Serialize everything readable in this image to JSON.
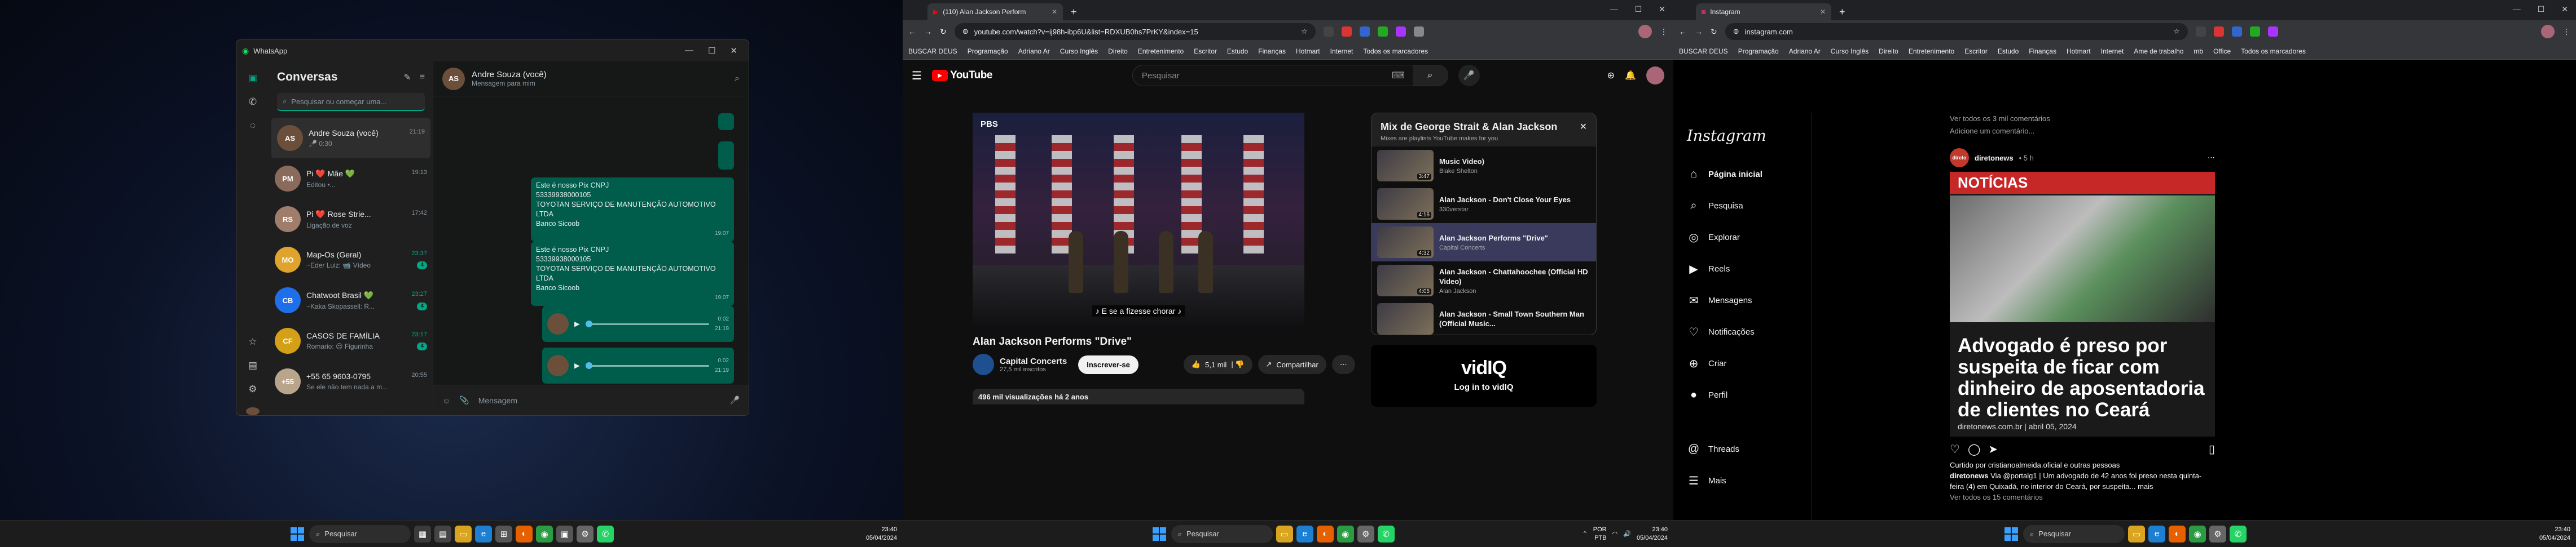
{
  "taskbar": {
    "search_placeholder": "Pesquisar",
    "time": "23:40",
    "date": "05/04/2024",
    "lang": "POR",
    "lang2": "PTB"
  },
  "whatsapp": {
    "title": "WhatsApp",
    "list_title": "Conversas",
    "search_placeholder": "Pesquisar ou começar uma...",
    "chats": [
      {
        "name": "Andre Souza (você)",
        "preview": "🎤 0:30",
        "time": "21:19",
        "badge": "",
        "color": "#6b4f3a",
        "initials": "AS"
      },
      {
        "name": "Pi ❤️ Mãe 💚",
        "preview": "Editou •...",
        "time": "19:13",
        "badge": "",
        "color": "#8a6a5a",
        "initials": "PM"
      },
      {
        "name": "Pi ❤️ Rose Strie...",
        "preview": "Ligação de voz",
        "time": "17:42",
        "badge": "",
        "color": "#a07d6a",
        "initials": "RS"
      },
      {
        "name": "Map-Os (Geral)",
        "preview": "~Eder Luiz: 📹 Vídeo",
        "time": "23:37",
        "badge": "4",
        "color": "#e0a32b",
        "initials": "MO"
      },
      {
        "name": "Chatwoot Brasil 💚",
        "preview": "~Kaka Skopassell: R...",
        "time": "23:27",
        "badge": "4",
        "color": "#1f6feb",
        "initials": "CB"
      },
      {
        "name": "CASOS DE FAMÍLIA",
        "preview": "Romario: 😍 Figurinha",
        "time": "23:17",
        "badge": "4",
        "color": "#d4a017",
        "initials": "CF"
      },
      {
        "name": "+55 65 9603-0795",
        "preview": "Se ele não tem nada a m...",
        "time": "20:55",
        "badge": "",
        "color": "#b8a58c",
        "initials": "+55"
      }
    ],
    "chat": {
      "name": "Andre Souza (você)",
      "subtitle": "Mensagem para mim",
      "messages": [
        {
          "text": "Este é nosso Pix CNPJ\n53339938000105\nTOYOTAN SERVIÇO DE MANUTENÇÃO AUTOMOTIVO LTDA\nBanco Sicoob",
          "time": "19:07"
        },
        {
          "text": "Este é nosso Pix CNPJ\n53339938000105\nTOYOTAN SERVIÇO DE MANUTENÇÃO AUTOMOTIVO LTDA\nBanco Sicoob",
          "time": "19:07"
        }
      ],
      "voice": [
        {
          "duration": "0:02",
          "time": "21:19"
        },
        {
          "duration": "0:02",
          "time": "21:19"
        }
      ],
      "compose_placeholder": "Mensagem"
    }
  },
  "youtube": {
    "tab_title": "(110) Alan Jackson Perform",
    "url": "youtube.com/watch?v=ij98h-ibp6U&list=RDXUB0hs7PrKY&index=15",
    "bookmarks": [
      "BUSCAR DEUS",
      "Programação",
      "Adriano Ar",
      "Curso Inglês",
      "Direito",
      "Entretenimento",
      "Escritor",
      "Estudo",
      "Finanças",
      "Hotmart",
      "Internet",
      "Todos os marcadores"
    ],
    "search_placeholder": "Pesquisar",
    "logo": "YouTube",
    "caption": "♪ E se a fizesse chorar ♪",
    "pbs": "PBS",
    "video_title": "Alan Jackson Performs \"Drive\"",
    "channel": "Capital Concerts",
    "subscribers": "27,5 mil inscritos",
    "subscribe": "Inscrever-se",
    "likes": "5,1 mil",
    "share": "Compartilhar",
    "views": "496 mil visualizações  há 2 anos",
    "mix_title": "Mix de George Strait & Alan Jackson",
    "mix_sub": "Mixes are playlists YouTube makes for you",
    "mix_items": [
      {
        "title": "Music Video)",
        "artist": "Blake Shelton",
        "duration": "3:47"
      },
      {
        "title": "Alan Jackson - Don't Close Your Eyes",
        "artist": "330verstar",
        "duration": "4:16"
      },
      {
        "title": "Alan Jackson Performs \"Drive\"",
        "artist": "Capital Concerts",
        "duration": "4:32"
      },
      {
        "title": "Alan Jackson - Chattahoochee (Official HD Video)",
        "artist": "Alan Jackson",
        "duration": "4:05"
      },
      {
        "title": "Alan Jackson - Small Town Southern Man (Official Music...",
        "artist": "",
        "duration": ""
      }
    ],
    "vidiq_logo": "vidIQ",
    "vidiq_login": "Log in to vidIQ"
  },
  "instagram": {
    "tab_title": "Instagram",
    "url": "instagram.com",
    "bookmarks": [
      "BUSCAR DEUS",
      "Programação",
      "Adriano Ar",
      "Curso Inglês",
      "Direito",
      "Entretenimento",
      "Escritor",
      "Estudo",
      "Finanças",
      "Hotmart",
      "Internet",
      "Ame de trabalho",
      "mb",
      "Office",
      "Todos os marcadores"
    ],
    "logo": "Instagram",
    "nav": [
      {
        "label": "Página inicial",
        "icon": "⌂"
      },
      {
        "label": "Pesquisa",
        "icon": "⌕"
      },
      {
        "label": "Explorar",
        "icon": "◎"
      },
      {
        "label": "Reels",
        "icon": "▶"
      },
      {
        "label": "Mensagens",
        "icon": "✉"
      },
      {
        "label": "Notificações",
        "icon": "♡"
      },
      {
        "label": "Criar",
        "icon": "⊕"
      },
      {
        "label": "Perfil",
        "icon": "●"
      }
    ],
    "nav_bottom": [
      {
        "label": "Threads",
        "icon": "@"
      },
      {
        "label": "Mais",
        "icon": "☰"
      }
    ],
    "top_comments": [
      "Ver todos os 3 mil comentários",
      "Adicione um comentário..."
    ],
    "post": {
      "user": "diretonews",
      "age": "• 5 h",
      "avatar_text": "direto",
      "tag": "NOTÍCIAS",
      "headline": "Advogado é preso por suspeita de ficar com dinheiro de aposentadoria de clientes no Ceará",
      "source": "diretonews.com.br  |  abril 05, 2024",
      "liked_by": "Curtido por cristianoalmeida.oficial e outras pessoas",
      "caption_user": "diretonews",
      "caption": "Via @portalg1 | Um advogado de 42 anos foi preso nesta quinta-feira (4) em Quixadá, no interior do Ceará, por suspeita... mais",
      "comments": "Ver todos os 15 comentários"
    }
  }
}
